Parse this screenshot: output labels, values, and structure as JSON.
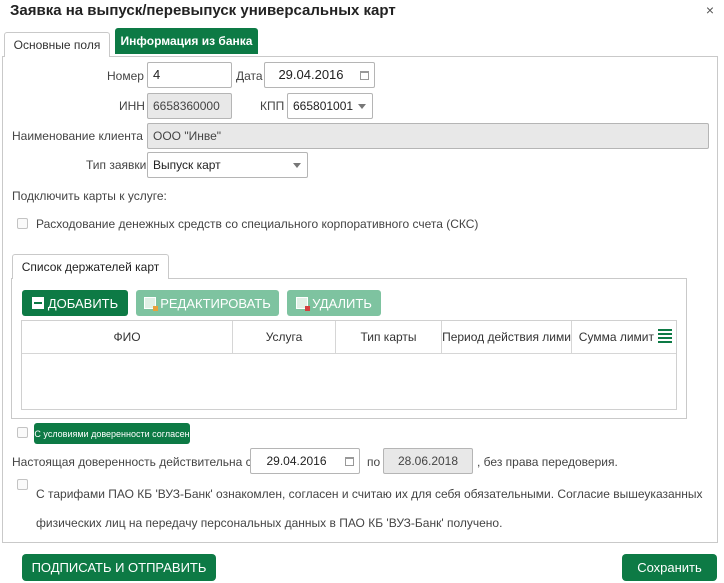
{
  "dialog": {
    "title": "Заявка на выпуск/перевыпуск универсальных карт",
    "close_label": "×"
  },
  "tabs": [
    {
      "label": "Основные поля",
      "active": true
    },
    {
      "label": "Информация из банка",
      "active": false
    }
  ],
  "form": {
    "number_label": "Номер",
    "number_value": "4",
    "date_label": "Дата",
    "date_value": "29.04.2016",
    "inn_label": "ИНН",
    "inn_value": "6658360000",
    "kpp_label": "КПП",
    "kpp_value": "665801001",
    "client_label": "Наименование клиента",
    "client_value": "ООО \"Инве\"",
    "request_type_label": "Тип заявки",
    "request_type_value": "Выпуск карт",
    "connect_label": "Подключить карты к услуге:",
    "sks_label": "Расходование денежных средств со специального корпоративного счета (СКС)"
  },
  "holders": {
    "tab_label": "Список держателей карт",
    "add_label": "ДОБАВИТЬ",
    "edit_label": "РЕДАКТИРОВАТЬ",
    "delete_label": "УДАЛИТЬ",
    "columns": [
      "ФИО",
      "Услуга",
      "Тип карты",
      "Период действия лими",
      "Сумма лимит"
    ]
  },
  "attorney": {
    "conditions_button": "С условиями доверенности согласен",
    "valid_prefix": "Настоящая доверенность действительна с",
    "from_date": "29.04.2016",
    "to_label": "по",
    "to_date": "28.06.2018",
    "suffix": ", без права передоверия."
  },
  "tariffs": {
    "line1": "С тарифами ПАО КБ 'ВУЗ-Банк' ознакомлен, согласен и считаю их для себя обязательными. Согласие вышеуказанных",
    "line2": "физических лиц на передачу персональных данных в ПАО КБ 'ВУЗ-Банк' получено."
  },
  "footer": {
    "sign_label": "ПОДПИСАТЬ И ОТПРАВИТЬ",
    "save_label": "Сохранить"
  },
  "colors": {
    "accent": "#0d7a45",
    "accent_disabled": "#7ec3a0"
  }
}
